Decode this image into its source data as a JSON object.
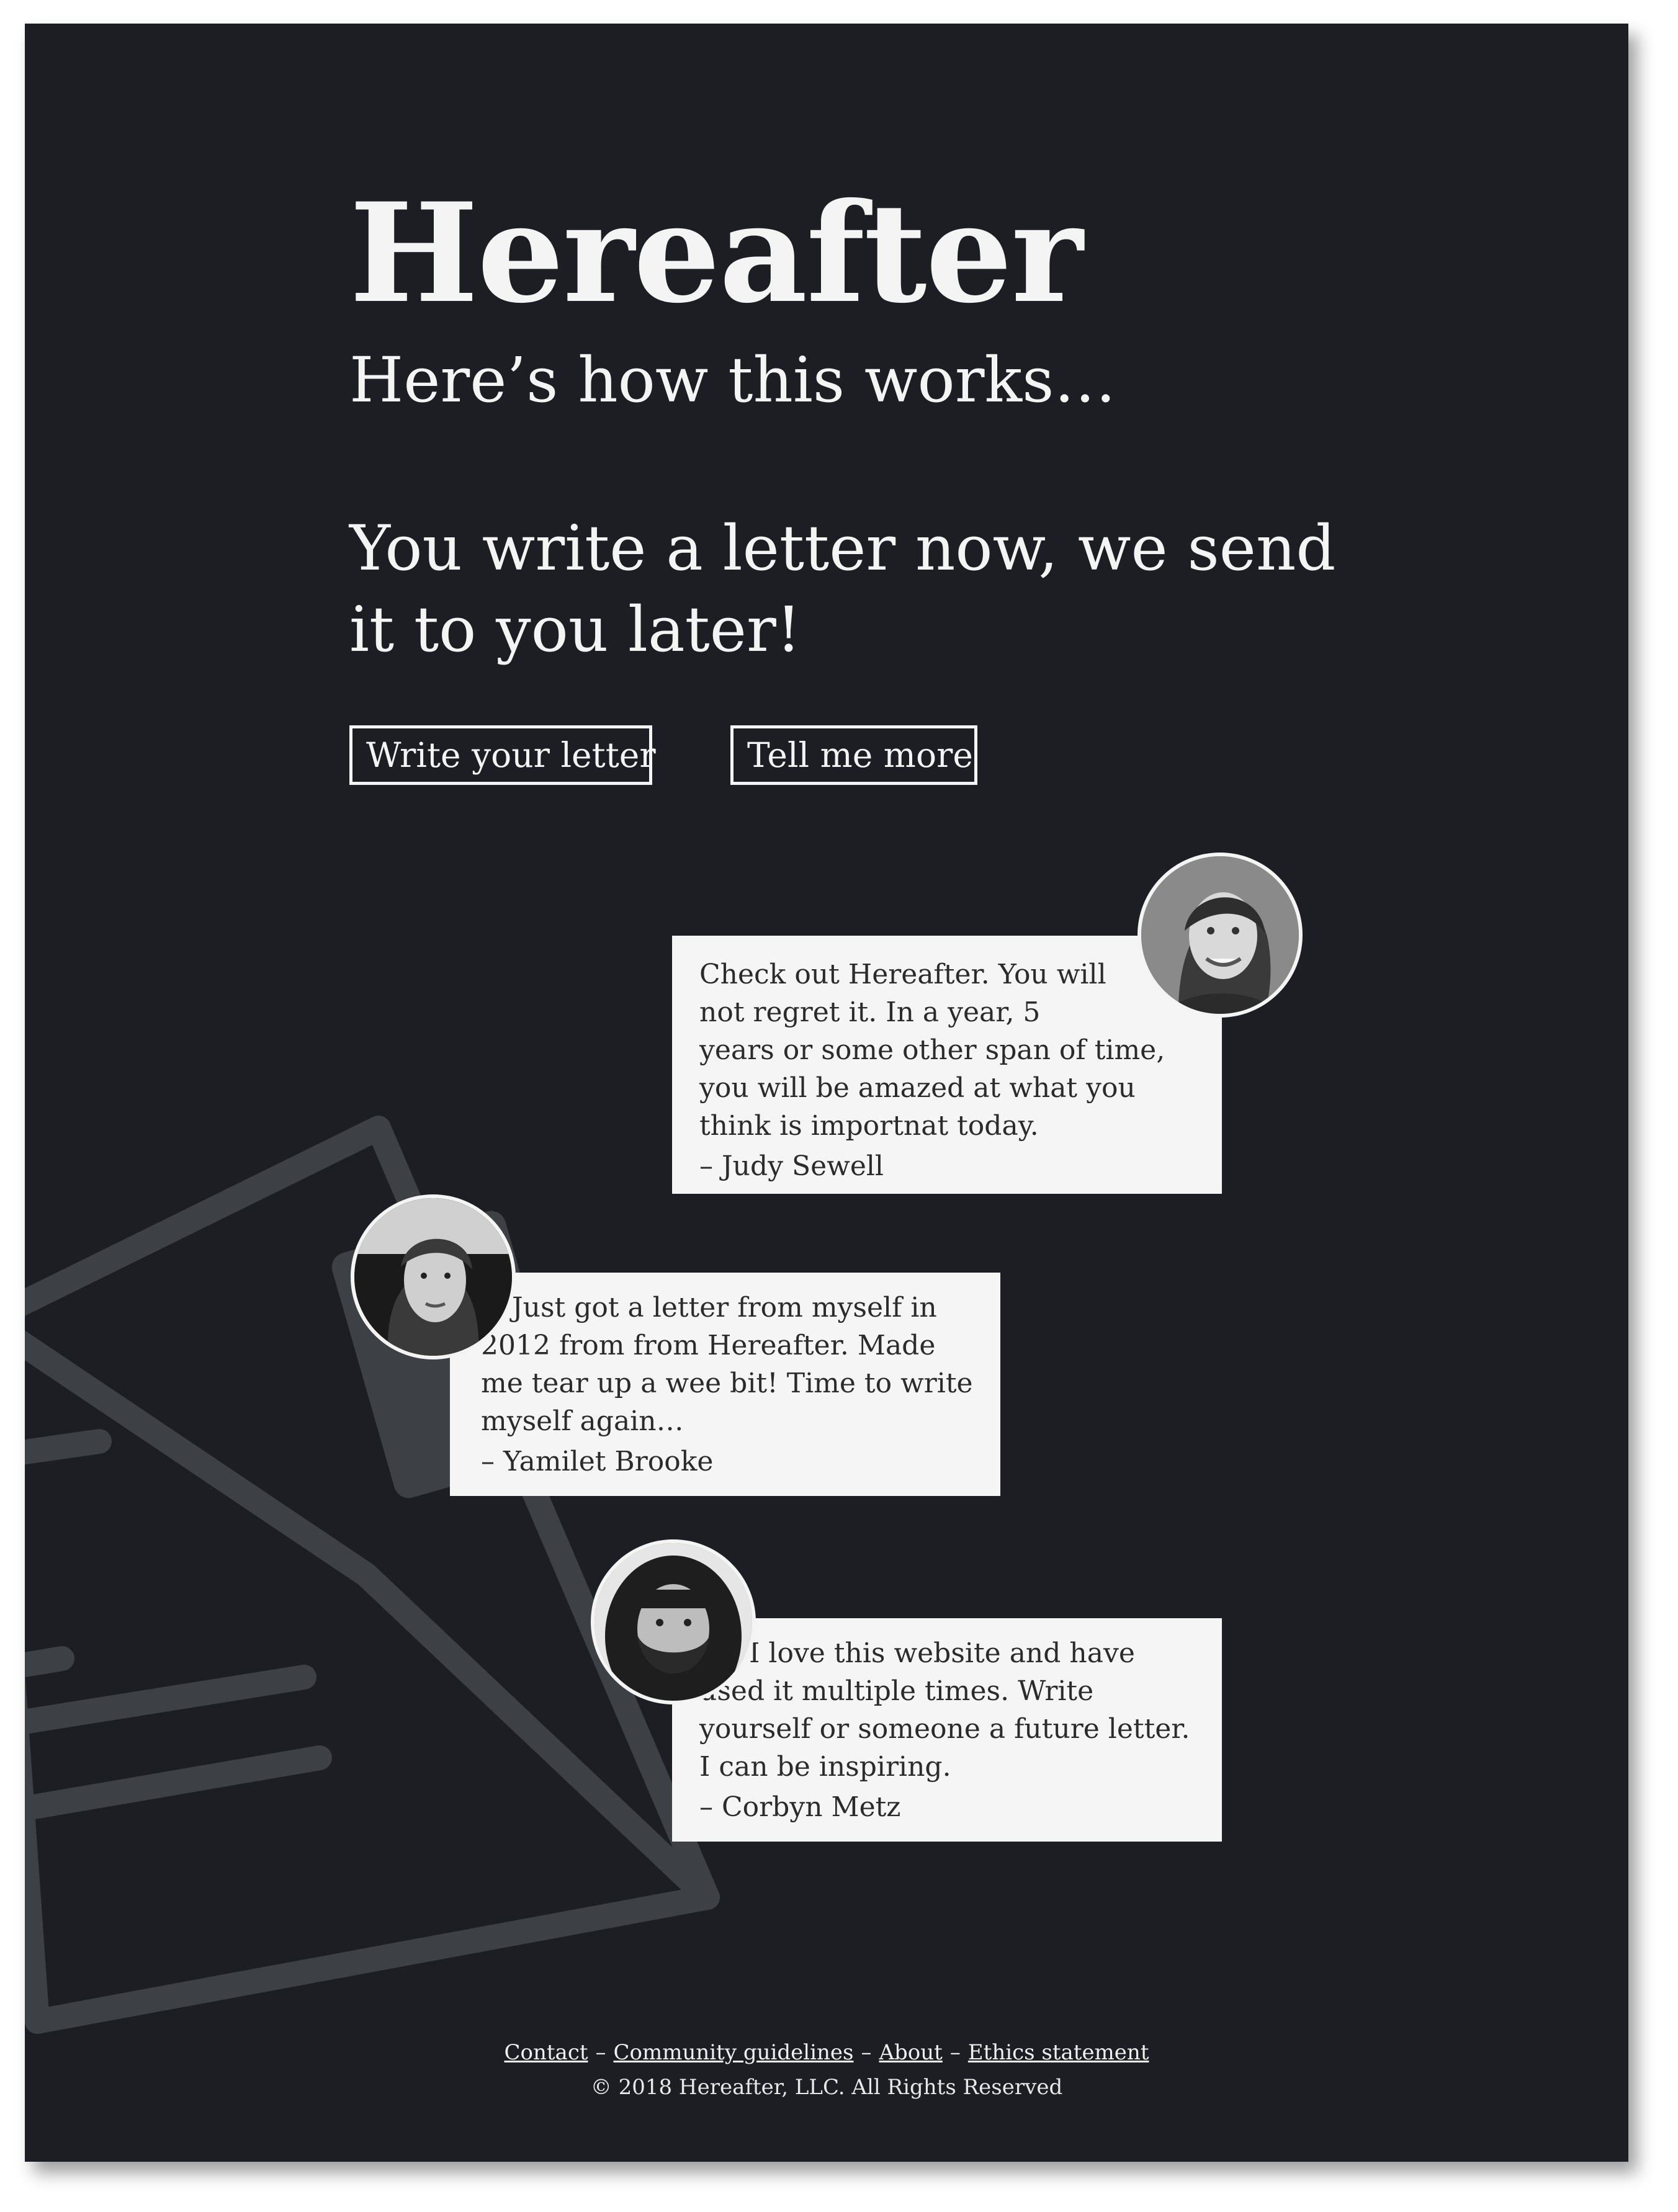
{
  "hero": {
    "title": "Hereafter",
    "subtitle": "Here’s how this works…",
    "tagline_line1": "You write a letter now, we send",
    "tagline_line2": "it to you later!"
  },
  "actions": {
    "write_label": "Write your letter",
    "more_label": "Tell me more"
  },
  "testimonials": [
    {
      "quote": "Check out Hereafter. You will not regret it. In a year, 5 years or some other span of time, you will be amazed at what you think is importnat today.",
      "author": "– Judy Sewell"
    },
    {
      "quote": "Just got a letter from myself in 2012 from from Hereafter. Made me tear up a wee bit! Time to write myself again…",
      "author": "– Yamilet Brooke"
    },
    {
      "quote": "I love this website and have used it multiple times. Write yourself or someone a future letter. I can be inspiring.",
      "author": "– Corbyn Metz"
    }
  ],
  "footer": {
    "links": [
      "Contact",
      "Community guidelines",
      "About",
      "Ethics statement"
    ],
    "separator": "–",
    "copyright": "© 2018 Hereafter, LLC. All Rights Reserved"
  },
  "colors": {
    "background": "#1c1e23",
    "card": "#f5f5f5",
    "text_light": "#f4f4f4",
    "envelope_graphic": "#3d4044"
  }
}
